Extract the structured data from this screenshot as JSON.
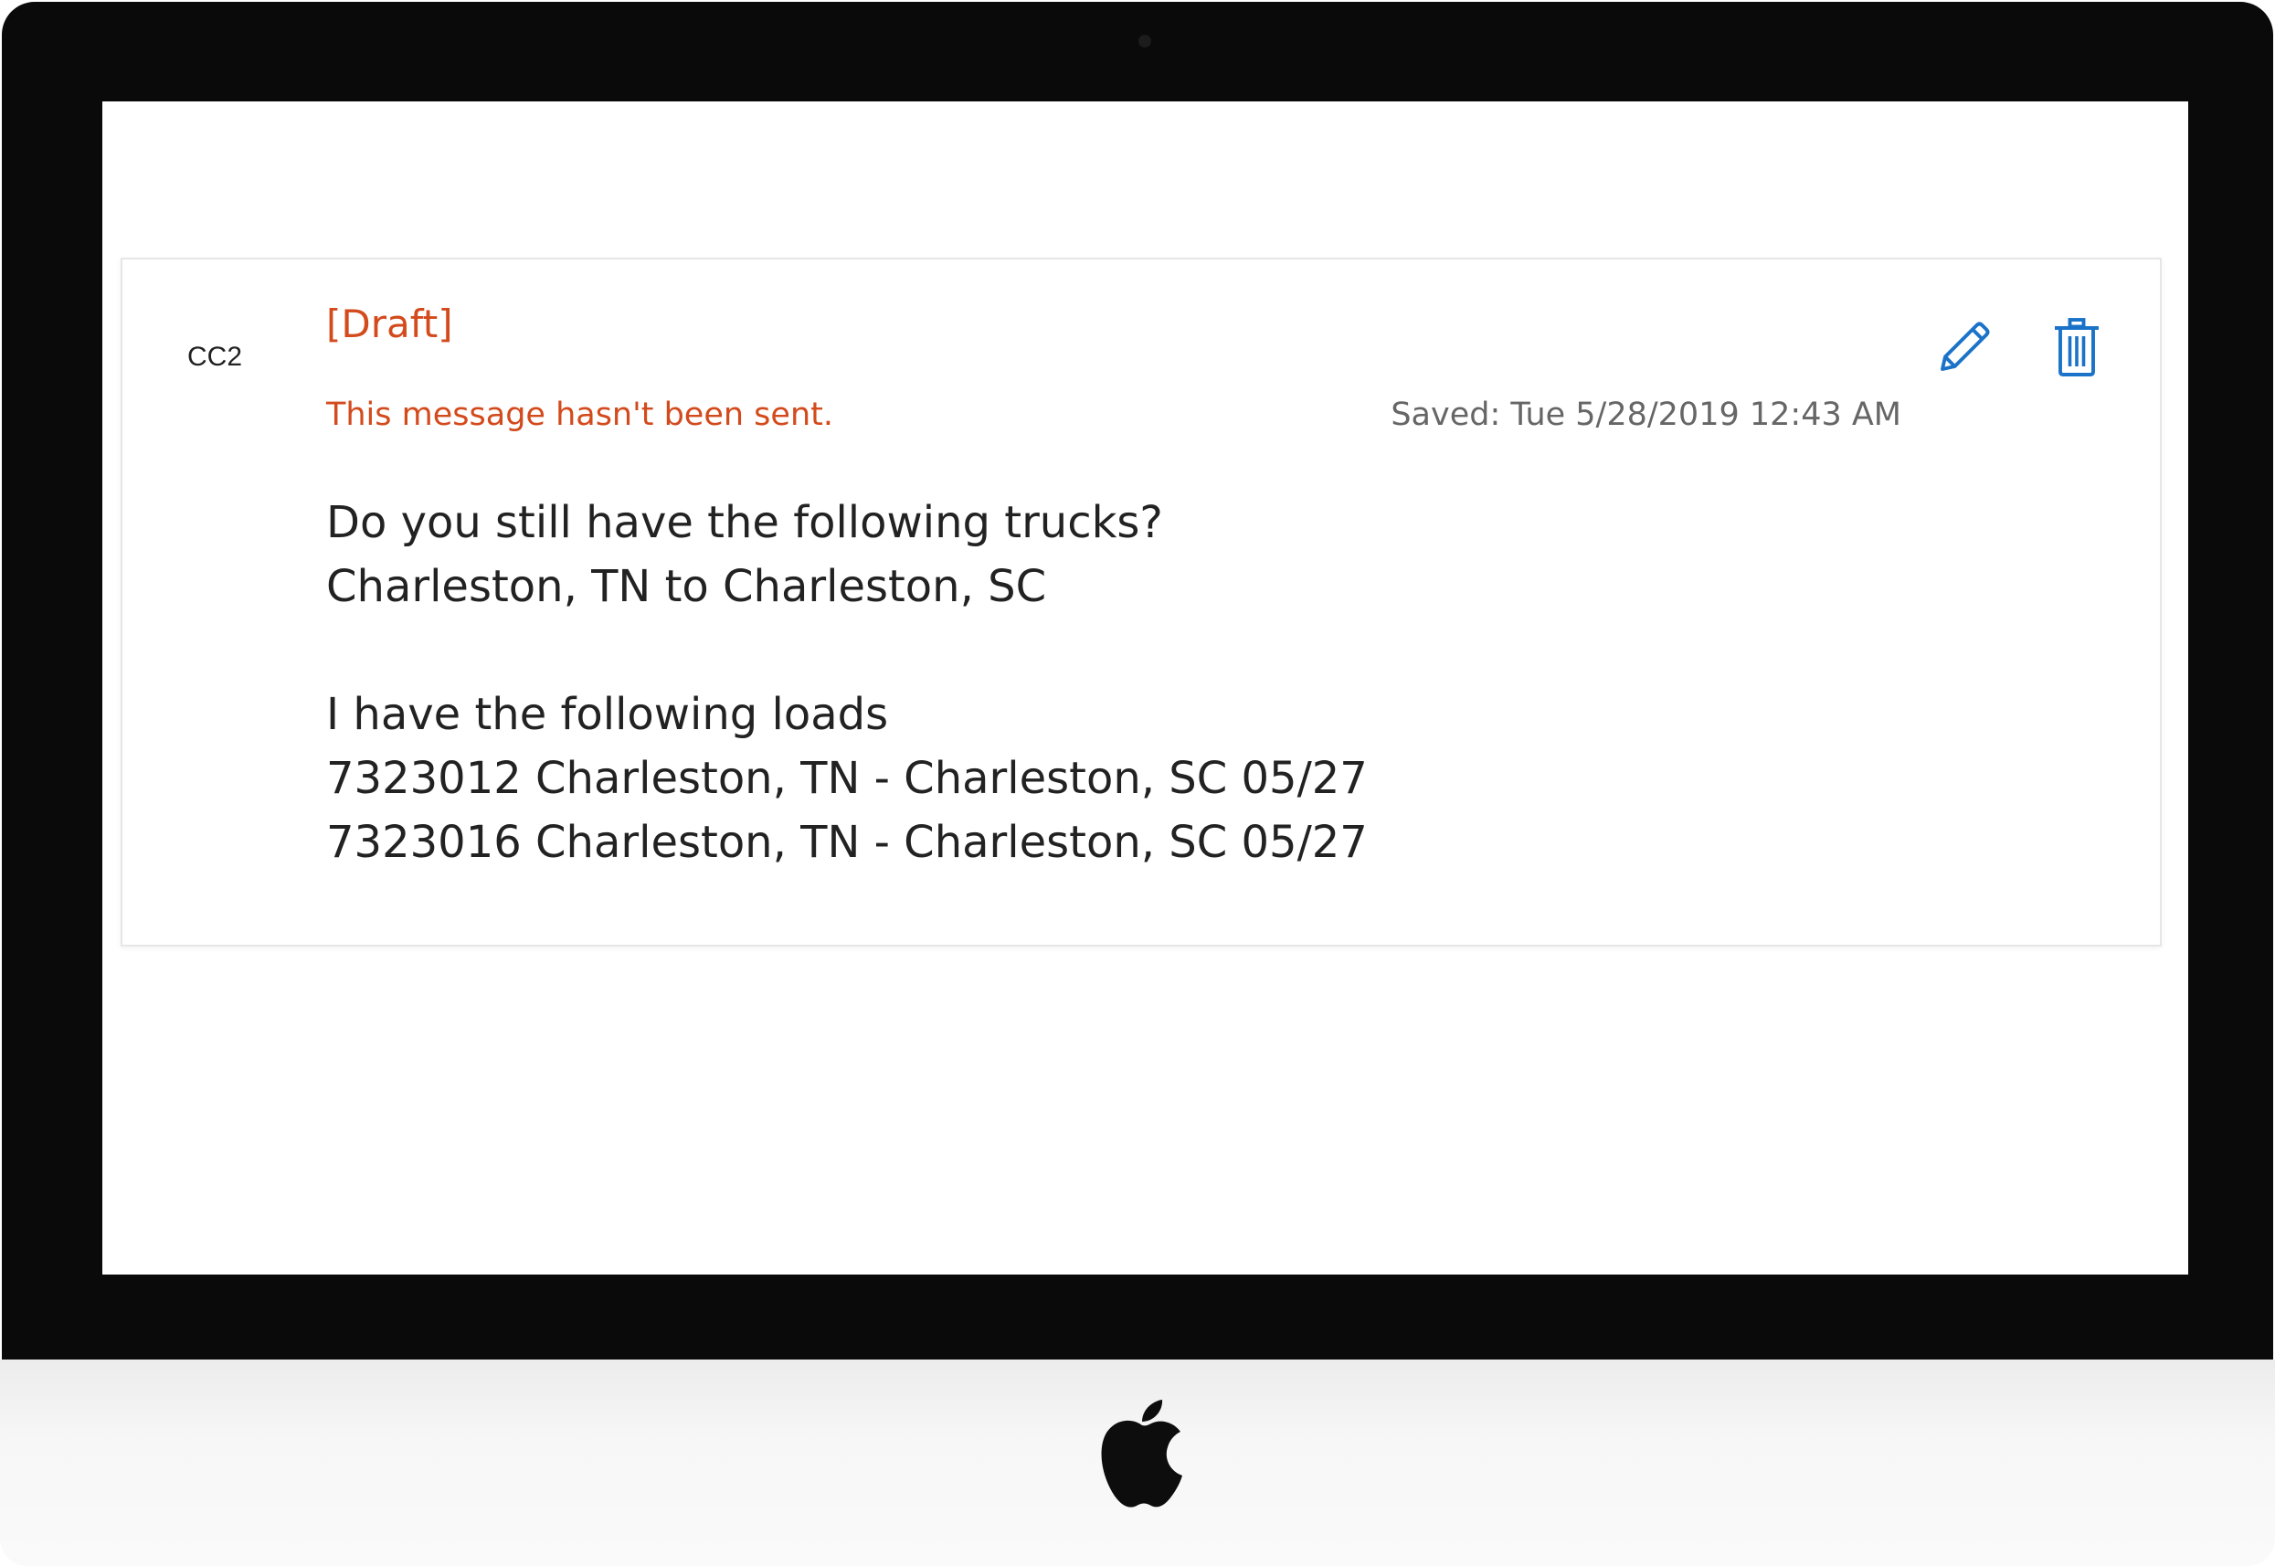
{
  "message": {
    "sender": "CC2",
    "draft_label": "[Draft]",
    "draft_notice": "This message hasn't been sent.",
    "saved_time": "Saved: Tue 5/28/2019 12:43 AM",
    "body_lines": [
      "Do you still have the following trucks?",
      "Charleston, TN to Charleston, SC",
      "",
      "I have the following loads",
      "7323012 Charleston, TN - Charleston, SC 05/27",
      "7323016 Charleston, TN - Charleston, SC 05/27"
    ]
  },
  "actions": {
    "edit_icon": "pencil-icon",
    "delete_icon": "trash-icon"
  },
  "colors": {
    "draft_accent": "#d34a1c",
    "action_icon": "#1a73c8",
    "bezel": "#0a0a0a"
  }
}
